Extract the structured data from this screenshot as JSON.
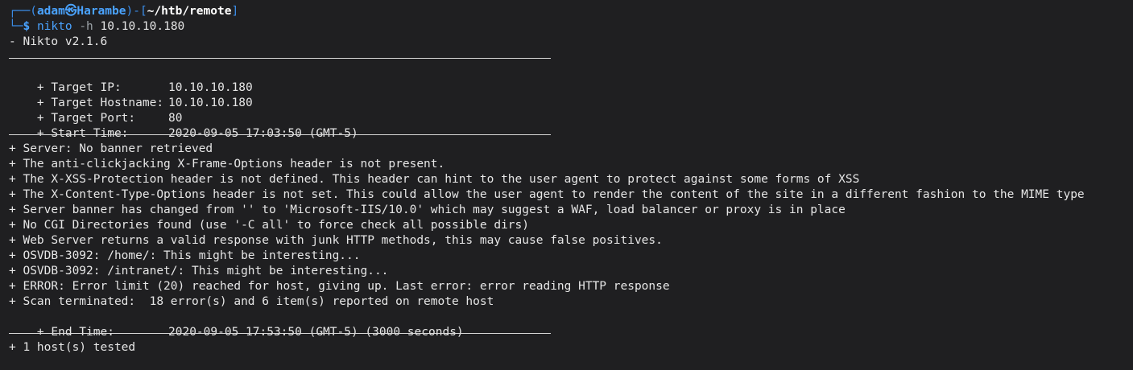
{
  "prompt": {
    "corner_top": "┌──",
    "open_paren": "(",
    "user_host": "adam㉿Harambe",
    "close_paren": ")",
    "dash": "-",
    "open_bracket": "[",
    "cwd": "~/htb/remote",
    "close_bracket": "]",
    "corner_bottom": "└─",
    "dollar": "$",
    "command": "nikto",
    "flag": "-h",
    "arg": "10.10.10.180"
  },
  "output": {
    "version": "- Nikto v2.1.6",
    "target": [
      {
        "label": "+ Target IP:",
        "value": "10.10.10.180"
      },
      {
        "label": "+ Target Hostname:",
        "value": "10.10.10.180"
      },
      {
        "label": "+ Target Port:",
        "value": "80"
      },
      {
        "label": "+ Start Time:",
        "value": "2020-09-05 17:03:50 (GMT-5)"
      }
    ],
    "findings": [
      "+ Server: No banner retrieved",
      "+ The anti-clickjacking X-Frame-Options header is not present.",
      "+ The X-XSS-Protection header is not defined. This header can hint to the user agent to protect against some forms of XSS",
      "+ The X-Content-Type-Options header is not set. This could allow the user agent to render the content of the site in a different fashion to the MIME type",
      "+ Server banner has changed from '' to 'Microsoft-IIS/10.0' which may suggest a WAF, load balancer or proxy is in place",
      "+ No CGI Directories found (use '-C all' to force check all possible dirs)",
      "+ Web Server returns a valid response with junk HTTP methods, this may cause false positives.",
      "+ OSVDB-3092: /home/: This might be interesting...",
      "+ OSVDB-3092: /intranet/: This might be interesting...",
      "+ ERROR: Error limit (20) reached for host, giving up. Last error: error reading HTTP response",
      "+ Scan terminated:  18 error(s) and 6 item(s) reported on remote host"
    ],
    "end_time": {
      "label": "+ End Time:",
      "value": "2020-09-05 17:53:50 (GMT-5) (3000 seconds)"
    },
    "summary": "+ 1 host(s) tested"
  },
  "colors": {
    "background": "#1f1f21",
    "prompt_blue": "#3b8eea",
    "text": "#e6e6e6"
  }
}
